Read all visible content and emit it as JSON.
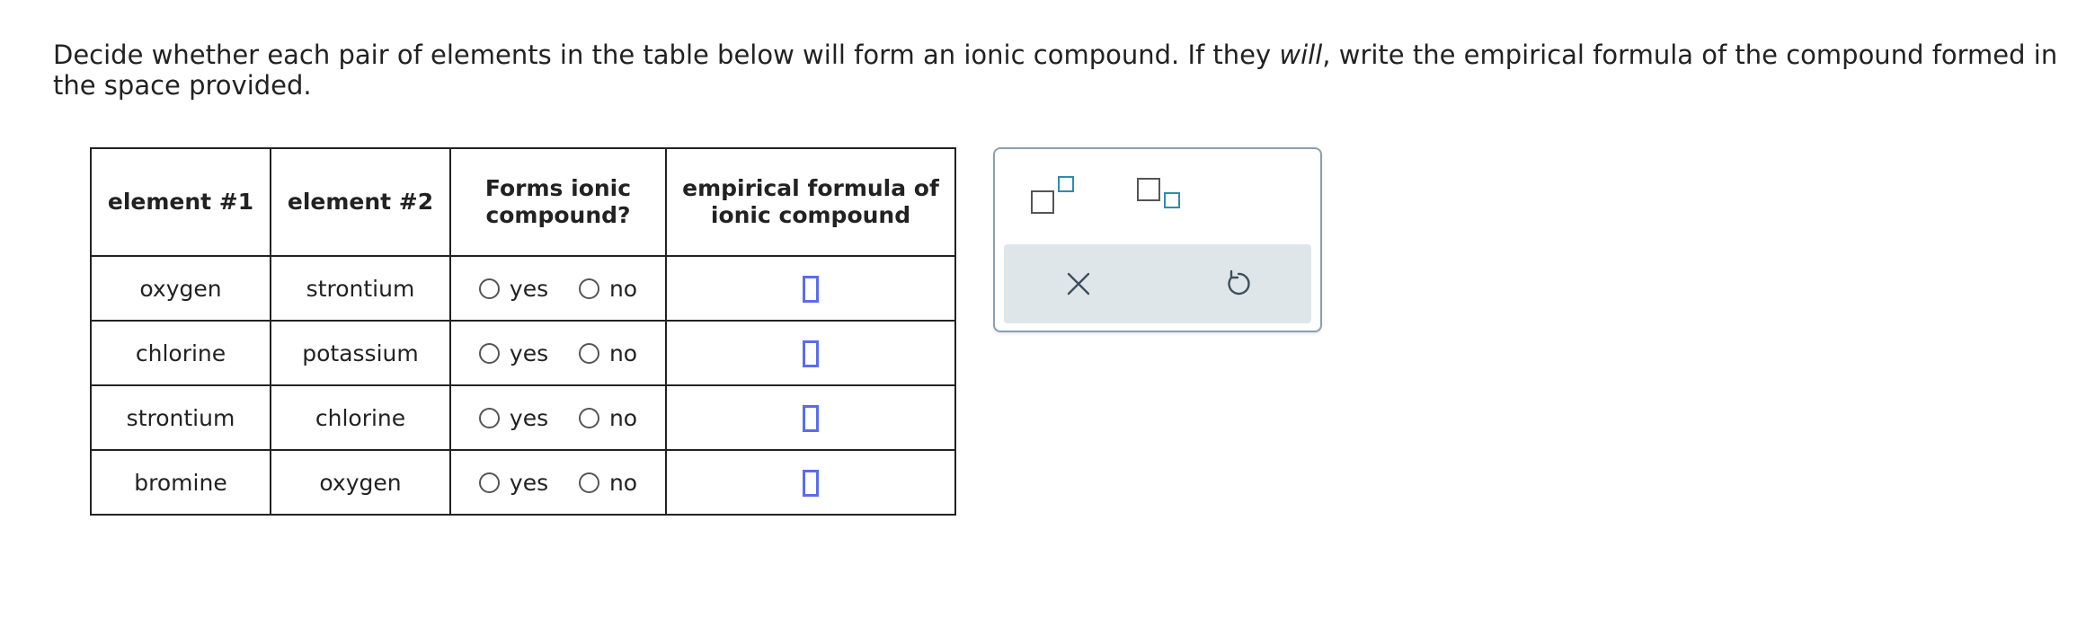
{
  "prompt": {
    "before": "Decide whether each pair of elements in the table below will form an ionic compound. If they ",
    "emphasis": "will",
    "after": ", write the empirical formula of the compound formed in the space provided."
  },
  "table": {
    "headers": {
      "element1": "element #1",
      "element2": "element #2",
      "forms_line1": "Forms ionic",
      "forms_line2": "compound?",
      "formula_line1": "empirical formula of",
      "formula_line2": "ionic compound"
    },
    "rows": [
      {
        "element1": "oxygen",
        "element2": "strontium",
        "yes": "yes",
        "no": "no"
      },
      {
        "element1": "chlorine",
        "element2": "potassium",
        "yes": "yes",
        "no": "no"
      },
      {
        "element1": "strontium",
        "element2": "chlorine",
        "yes": "yes",
        "no": "no"
      },
      {
        "element1": "bromine",
        "element2": "oxygen",
        "yes": "yes",
        "no": "no"
      }
    ]
  },
  "palette": {
    "tools": [
      "superscript-icon",
      "subscript-icon"
    ],
    "actions": [
      "close-icon",
      "undo-icon"
    ],
    "colors": {
      "border": "#8aa0b0",
      "actions_bg": "#dfe6e9",
      "accent": "#2b8fa6",
      "answer_box": "#5b6de8"
    }
  }
}
